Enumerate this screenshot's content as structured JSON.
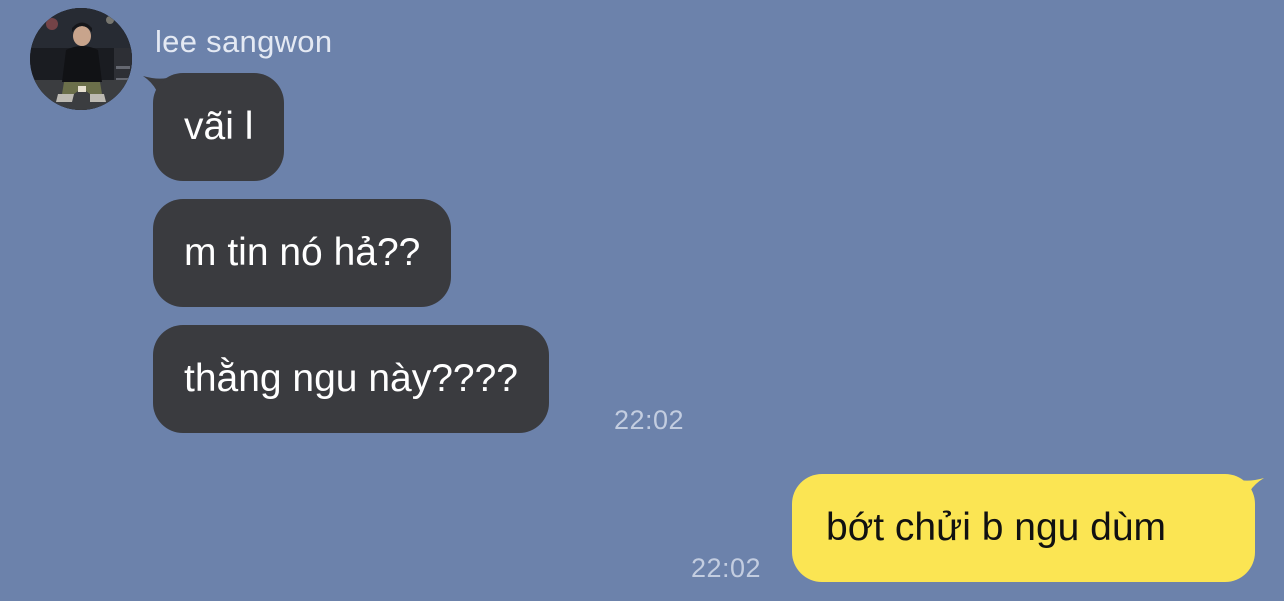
{
  "colors": {
    "background": "#6c82ab",
    "incoming_bubble": "#3a3b3f",
    "incoming_text": "#ffffff",
    "outgoing_bubble": "#fbe553",
    "outgoing_text": "#111111",
    "sender_name": "#e4e9f3",
    "timestamp": "#c3cde0"
  },
  "contact": {
    "name": "lee sangwon",
    "avatar_icon": "profile-photo"
  },
  "messages": [
    {
      "direction": "incoming",
      "text": "vãi l"
    },
    {
      "direction": "incoming",
      "text": "m tin nó hả??"
    },
    {
      "direction": "incoming",
      "text": "thằng ngu này????",
      "time": "22:02"
    },
    {
      "direction": "outgoing",
      "text": "bớt chửi b ngu dùm",
      "time": "22:02"
    }
  ]
}
